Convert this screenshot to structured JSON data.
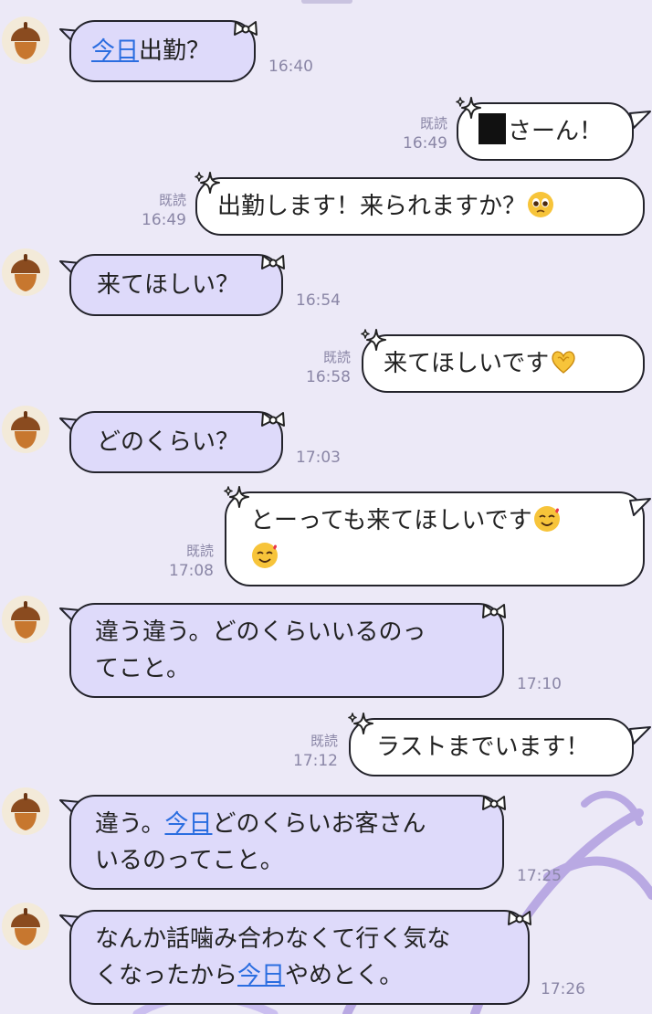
{
  "messages": [
    {
      "side": "in",
      "pre_link": "",
      "link": "今日",
      "post_link": "出勤？",
      "time": "16:40"
    },
    {
      "side": "out",
      "text": "さーん！",
      "read": "既読",
      "time": "16:49"
    },
    {
      "side": "out",
      "text": "出勤します！来られますか？",
      "read": "既読",
      "time": "16:49"
    },
    {
      "side": "in",
      "text": "来てほしい？",
      "time": "16:54"
    },
    {
      "side": "out",
      "text": "来てほしいです",
      "read": "既読",
      "time": "16:58"
    },
    {
      "side": "in",
      "text": "どのくらい？",
      "time": "17:03"
    },
    {
      "side": "out",
      "text": "とーっても来てほしいです",
      "read": "既読",
      "time": "17:08"
    },
    {
      "side": "in",
      "line1": "違う違う。どのくらいいるのっ",
      "line2": "てこと。",
      "time": "17:10"
    },
    {
      "side": "out",
      "text": "ラストまでいます！",
      "read": "既読",
      "time": "17:12"
    },
    {
      "side": "in",
      "pre_link": "違う。",
      "link": "今日",
      "post_link": "どのくらいお客さん",
      "line2": "いるのってこと。",
      "time": "17:25"
    },
    {
      "side": "in",
      "line1": "なんか話噛み合わなくて行く気な",
      "pre_link": "くなったから",
      "link": "今日",
      "post_link": "やめとく。",
      "time": "17:26"
    }
  ],
  "icons": {
    "avatar": "acorn-icon",
    "in_deco": "ribbon-icon",
    "out_deco": "sparkle-icon",
    "emoji_pleading": "pleading-face-emoji",
    "emoji_heart_hands": "heart-hands-emoji",
    "emoji_smiling_hearts": "smiling-face-with-hearts-emoji"
  },
  "colors": {
    "background": "#ece9f7",
    "incoming_bubble": "#dedafa",
    "outgoing_bubble": "#ffffff",
    "border": "#23232b",
    "link": "#2a6de0",
    "meta": "#8a86a6"
  }
}
